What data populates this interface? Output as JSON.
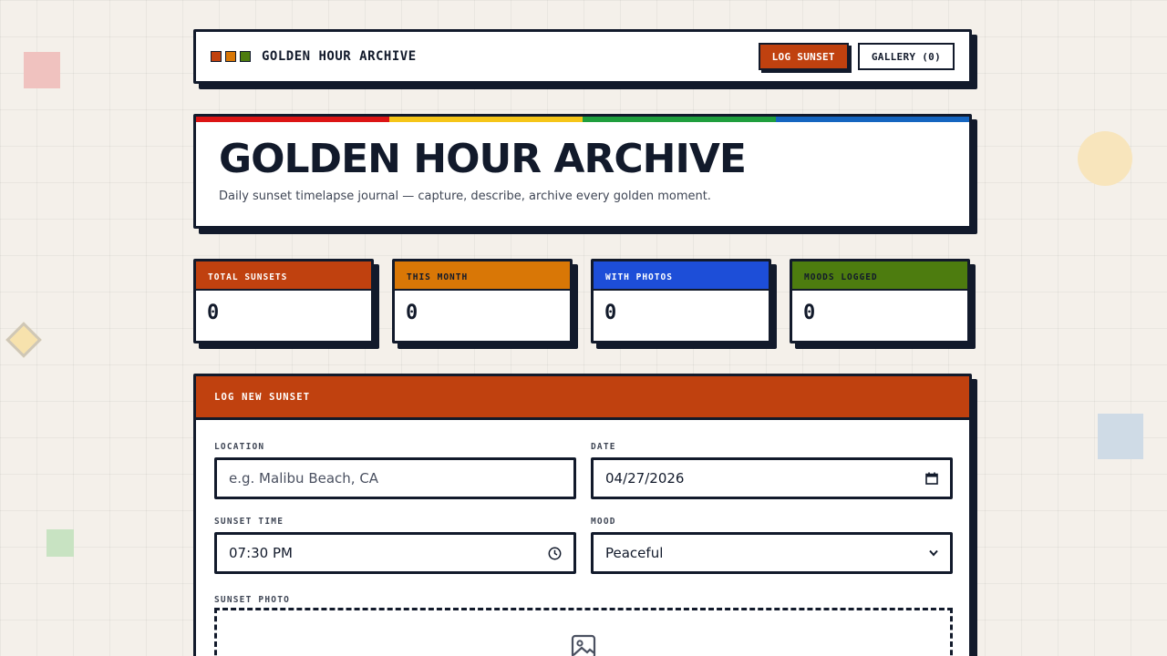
{
  "brand": {
    "title": "GOLDEN HOUR ARCHIVE",
    "logo_colors": [
      "#c0410f",
      "#d97706",
      "#4d7c0f"
    ]
  },
  "nav": {
    "log_button": "LOG SUNSET",
    "gallery_button": "GALLERY (0)"
  },
  "hero": {
    "title": "GOLDEN HOUR ARCHIVE",
    "subtitle": "Daily sunset timelapse journal — capture, describe, archive every golden moment.",
    "stripe_colors": [
      "#dc1414",
      "#f5c518",
      "#1f9e3d",
      "#1565c0"
    ]
  },
  "stats": [
    {
      "label": "TOTAL SUNSETS",
      "value": "0",
      "color": "#c0410f",
      "text_color": "#ffffff"
    },
    {
      "label": "THIS MONTH",
      "value": "0",
      "color": "#d97706",
      "text_color": "#121a2b"
    },
    {
      "label": "WITH PHOTOS",
      "value": "0",
      "color": "#1d4ed8",
      "text_color": "#ffffff"
    },
    {
      "label": "MOODS LOGGED",
      "value": "0",
      "color": "#4d7c0f",
      "text_color": "#121a2b"
    }
  ],
  "form": {
    "title": "LOG NEW SUNSET",
    "location": {
      "label": "LOCATION",
      "placeholder": "e.g. Malibu Beach, CA",
      "value": ""
    },
    "date": {
      "label": "DATE",
      "value": "04/27/2026"
    },
    "time": {
      "label": "SUNSET TIME",
      "value": "07:30 PM"
    },
    "mood": {
      "label": "MOOD",
      "value": "Peaceful"
    },
    "photo": {
      "label": "SUNSET PHOTO"
    }
  },
  "icons": {
    "calendar": "calendar-icon",
    "clock": "clock-icon",
    "chevron": "chevron-down-icon",
    "image": "image-icon"
  },
  "colors": {
    "accent": "#c0410f",
    "ink": "#121a2b",
    "background": "#f4f0ea"
  }
}
